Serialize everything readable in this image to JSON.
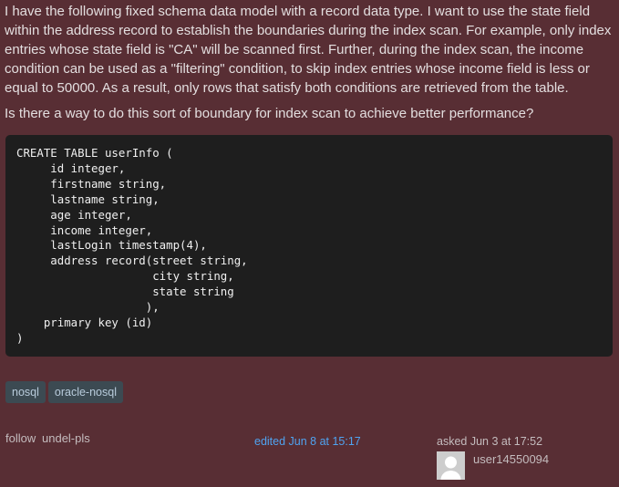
{
  "question": {
    "paragraphs": [
      "I have the following fixed schema data model with a record data type. I want to use the state field within the address record to establish the boundaries during the index scan. For example, only index entries whose state field is \"CA\" will be scanned first. Further, during the index scan, the income condition can be used as a \"filtering\" condition, to skip index entries whose income field is less or equal to 50000. As a result, only rows that satisfy both conditions are retrieved from the table.",
      "Is there a way to do this sort of boundary for index scan to achieve better performance?"
    ],
    "code": "CREATE TABLE userInfo (\n     id integer,\n     firstname string,\n     lastname string,\n     age integer,\n     income integer,\n     lastLogin timestamp(4),\n     address record(street string,\n                    city string,\n                    state string\n                   ),\n    primary key (id)\n)"
  },
  "tags": [
    "nosql",
    "oracle-nosql"
  ],
  "actions": {
    "follow": "follow",
    "undelete": "undel-pls"
  },
  "edited": "edited Jun 8 at 15:17",
  "asked": "asked Jun 3 at 17:52",
  "user": {
    "name": "user14550094",
    "avatar_icon": "default-user-avatar-icon"
  }
}
